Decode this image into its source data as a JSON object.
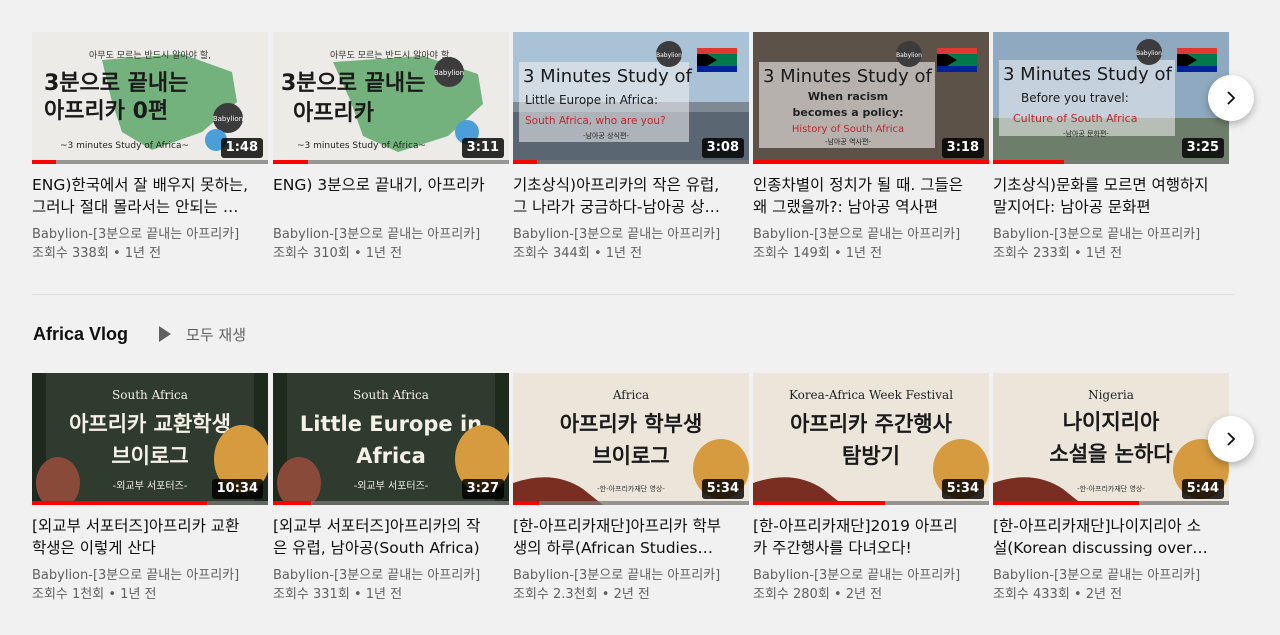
{
  "shelves": [
    {
      "videos": [
        {
          "thumb": {
            "top": "아무도 모르는 반드시 알아야 할,",
            "line1": "3분으로 끝내는",
            "line2": "아프리카 0편",
            "sub": "~3 minutes Study of Africa~",
            "badge": "Babylion"
          },
          "duration": "1:48",
          "progress": 0.1,
          "title": "ENG)한국에서 잘 배우지 못하는, 그러나 절대 몰라서는 안되는 아프리카",
          "channel": "Babylion-[3분으로 끝내는 아프리카]",
          "views": "조회수 338회",
          "age": "1년 전"
        },
        {
          "thumb": {
            "top": "아무도 모르는 반드시 알아야 할,",
            "line1": "3분으로 끝내는",
            "line2": "아프리카",
            "sub": "~3 minutes Study of Africa~",
            "badge": "Babylion"
          },
          "duration": "3:11",
          "progress": 0.15,
          "title": "ENG) 3분으로 끝내기, 아프리카",
          "channel": "Babylion-[3분으로 끝내는 아프리카]",
          "views": "조회수 310회",
          "age": "1년 전"
        },
        {
          "thumb": {
            "line1": "3 Minutes Study of",
            "line2": "Little Europe in Africa:",
            "line3": "South Africa, who are you?",
            "sub": "-남아공 상식편-",
            "badge": "Babylion"
          },
          "duration": "3:08",
          "progress": 0.1,
          "title": "기초상식)아프리카의 작은 유럽, 그 나라가 궁금하다-남아공 상식편",
          "channel": "Babylion-[3분으로 끝내는 아프리카]",
          "views": "조회수 344회",
          "age": "1년 전"
        },
        {
          "thumb": {
            "line1": "3 Minutes Study of",
            "line2": "When racism",
            "line3": "becomes a policy:",
            "line4": "History of South Africa",
            "sub": "-남아공 역사편-",
            "badge": "Babylion"
          },
          "duration": "3:18",
          "progress": 1.0,
          "title": "인종차별이 정치가 될 때. 그들은 왜 그랬을까?: 남아공 역사편",
          "channel": "Babylion-[3분으로 끝내는 아프리카]",
          "views": "조회수 149회",
          "age": "1년 전"
        },
        {
          "thumb": {
            "line1": "3 Minutes Study of",
            "line2": "Before you travel:",
            "line3": "Culture of South Africa",
            "sub": "-남아공 문화편-",
            "badge": "Babylion"
          },
          "duration": "3:25",
          "progress": 0.3,
          "title": "기초상식)문화를 모르면 여행하지 말지어다: 남아공 문화편",
          "channel": "Babylion-[3분으로 끝내는 아프리카]",
          "views": "조회수 233회",
          "age": "1년 전"
        }
      ]
    },
    {
      "title": "Africa Vlog",
      "play_all_label": "모두 재생",
      "videos": [
        {
          "thumb": {
            "top": "South Africa",
            "line1": "아프리카 교환학생",
            "line2": "브이로그",
            "sub": "-외교부 서포터즈-"
          },
          "duration": "10:34",
          "progress": 0.74,
          "title": "[외교부 서포터즈]아프리카 교환학생은 이렇게 산다",
          "channel": "Babylion-[3분으로 끝내는 아프리카]",
          "views": "조회수 1천회",
          "age": "1년 전"
        },
        {
          "thumb": {
            "top": "South Africa",
            "line1": "Little Europe in",
            "line2": "Africa",
            "sub": "-외교부 서포터즈-"
          },
          "duration": "3:27",
          "progress": 0.16,
          "title": "[외교부 서포터즈]아프리카의 작은 유럽, 남아공(South Africa)",
          "channel": "Babylion-[3분으로 끝내는 아프리카]",
          "views": "조회수 331회",
          "age": "1년 전"
        },
        {
          "thumb": {
            "top": "Africa",
            "line1": "아프리카 학부생",
            "line2": "브이로그",
            "sub": "-한-아프리카재단 영상-"
          },
          "duration": "5:34",
          "progress": 0.11,
          "title": "[한-아프리카재단]아프리카 학부생의 하루(African Studies Student Vlog)",
          "channel": "Babylion-[3분으로 끝내는 아프리카]",
          "views": "조회수 2.3천회",
          "age": "2년 전"
        },
        {
          "thumb": {
            "top": "Korea-Africa Week Festival",
            "line1": "아프리카 주간행사",
            "line2": "탐방기",
            "sub": ""
          },
          "duration": "5:34",
          "progress": 0.56,
          "title": "[한-아프리카재단]2019 아프리카 주간행사를 다녀오다!",
          "channel": "Babylion-[3분으로 끝내는 아프리카]",
          "views": "조회수 280회",
          "age": "2년 전"
        },
        {
          "thumb": {
            "top": "Nigeria",
            "line1": "나이지리아",
            "line2": "소설을 논하다",
            "sub": "-한-아프리카재단 영상-"
          },
          "duration": "5:44",
          "progress": 0.62,
          "title": "[한-아프리카재단]나이지리아 소설(Korean discussing over Nigerian novel)",
          "channel": "Babylion-[3분으로 끝내는 아프리카]",
          "views": "조회수 433회",
          "age": "2년 전"
        }
      ]
    }
  ],
  "separator": "•",
  "icons": {
    "next": "chevron-right-icon",
    "play": "play-icon"
  },
  "colors": {
    "progress": "#ff0000",
    "background": "#f1f1f1",
    "meta": "#606060"
  }
}
